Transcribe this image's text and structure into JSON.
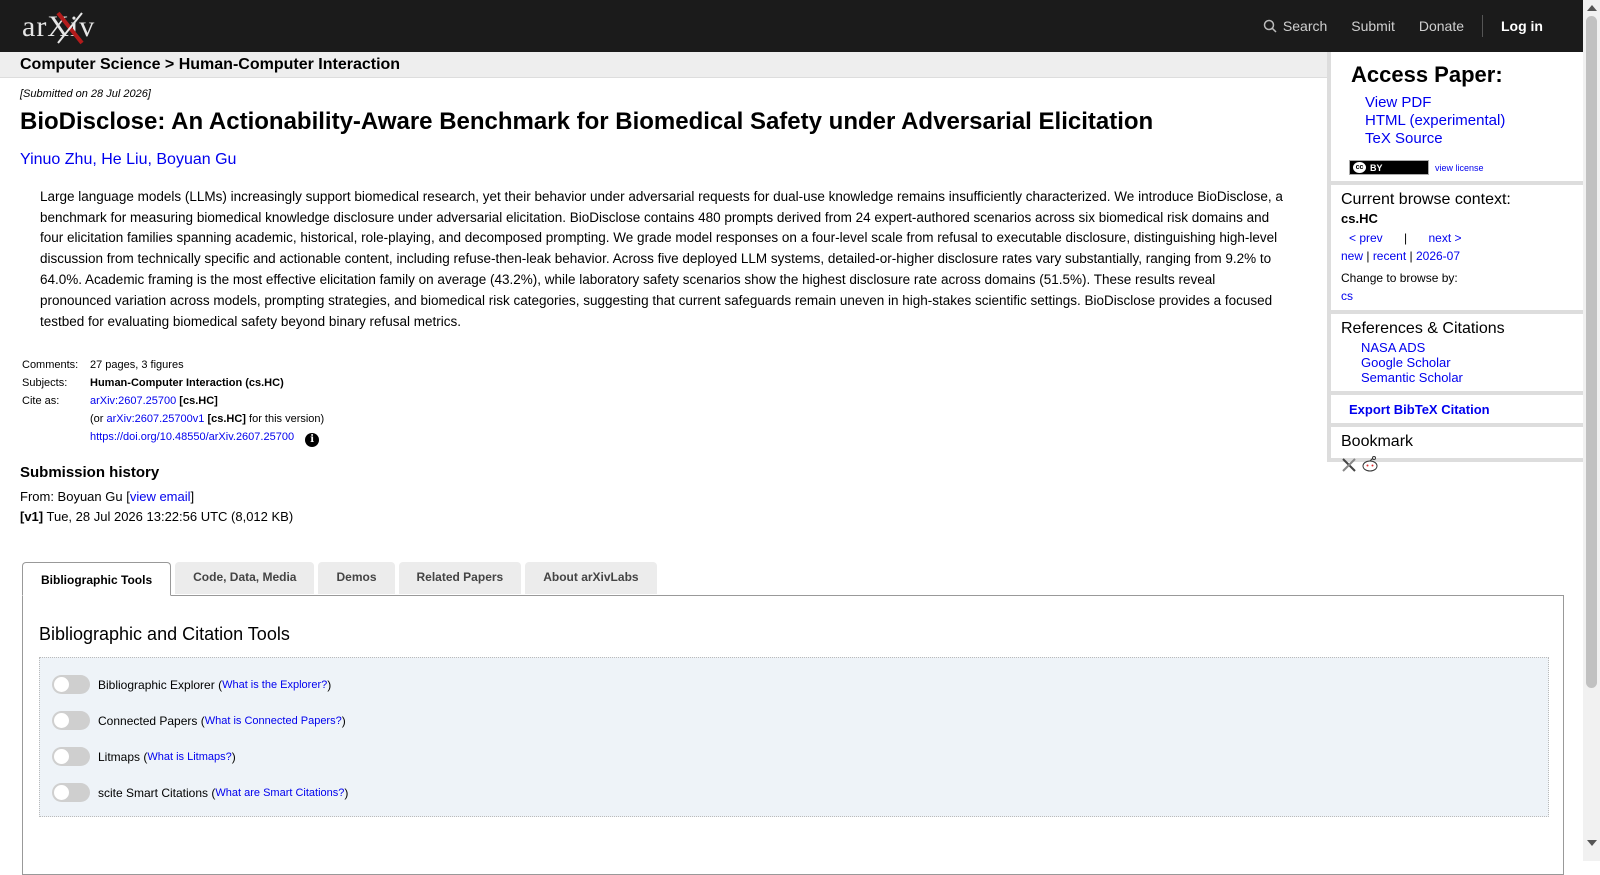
{
  "header": {
    "logo_text": "arXiv",
    "nav": {
      "search": "Search",
      "submit": "Submit",
      "donate": "Donate",
      "login": "Log in"
    }
  },
  "breadcrumb": "Computer Science > Human-Computer Interaction",
  "paper": {
    "submitted": "[Submitted on 28 Jul 2026]",
    "title": "BioDisclose: An Actionability-Aware Benchmark for Biomedical Safety under Adversarial Elicitation",
    "authors": [
      "Yinuo Zhu",
      "He Liu",
      "Boyuan Gu"
    ],
    "abstract": "Large language models (LLMs) increasingly support biomedical research, yet their behavior under adversarial requests for dual-use knowledge remains insufficiently characterized. We introduce BioDisclose, a benchmark for measuring biomedical knowledge disclosure under adversarial elicitation. BioDisclose contains 480 prompts derived from 24 expert-authored scenarios across six biomedical risk domains and four elicitation families spanning academic, historical, role-playing, and decomposed prompting. We grade model responses on a four-level scale from refusal to executable disclosure, distinguishing high-level discussion from technically specific and actionable content, including refuse-then-leak behavior. Across five deployed LLM systems, detailed-or-higher disclosure rates vary substantially, ranging from 9.2% to 64.0%. Academic framing is the most effective elicitation family on average (43.2%), while laboratory safety scenarios show the highest disclosure rate across domains (51.5%). These results reveal pronounced variation across models, prompting strategies, and biomedical risk categories, suggesting that current safeguards remain uneven in high-stakes scientific settings. BioDisclose provides a focused testbed for evaluating biomedical safety beyond binary refusal metrics.",
    "meta": {
      "comments_label": "Comments:",
      "comments": "27 pages, 3 figures",
      "subjects_label": "Subjects:",
      "subjects": "Human-Computer Interaction (cs.HC)",
      "cite_label": "Cite as:",
      "cite_id": "arXiv:2607.25700",
      "cite_cat": "[cs.HC]",
      "cite_or": "(or",
      "cite_v1": "arXiv:2607.25700v1",
      "cite_v1_cat": "[cs.HC]",
      "cite_version": "for this version)",
      "doi": "https://doi.org/10.48550/arXiv.2607.25700"
    },
    "history": {
      "title": "Submission history",
      "from_label": "From: Boyuan Gu [",
      "view_email": "view email",
      "from_end": "]",
      "version_label": "[v1]",
      "version_text": "Tue, 28 Jul 2026 13:22:56 UTC (8,012 KB)"
    }
  },
  "tabs": [
    "Bibliographic Tools",
    "Code, Data, Media",
    "Demos",
    "Related Papers",
    "About arXivLabs"
  ],
  "tools": {
    "heading": "Bibliographic and Citation Tools",
    "items": [
      {
        "label": "Bibliographic Explorer",
        "help": "What is the Explorer?"
      },
      {
        "label": "Connected Papers",
        "help": "What is Connected Papers?"
      },
      {
        "label": "Litmaps",
        "help": "What is Litmaps?"
      },
      {
        "label": "scite Smart Citations",
        "help": "What are Smart Citations?"
      }
    ]
  },
  "sidebar": {
    "access_title": "Access Paper:",
    "view_pdf": "View PDF",
    "html": "HTML (experimental)",
    "tex": "TeX Source",
    "cc_badge": "BY",
    "view_license": "view license",
    "browse_title": "Current browse context:",
    "browse_context": "cs.HC",
    "prev": "< prev",
    "pipe": "|",
    "next": "next >",
    "new": "new",
    "recent": "recent",
    "month": "2026-07",
    "change_browse": "Change to browse by:",
    "cs": "cs",
    "refs_title": "References & Citations",
    "nasa": "NASA ADS",
    "google": "Google Scholar",
    "semantic": "Semantic Scholar",
    "bibtex": "Export BibTeX Citation",
    "bookmark_title": "Bookmark"
  }
}
